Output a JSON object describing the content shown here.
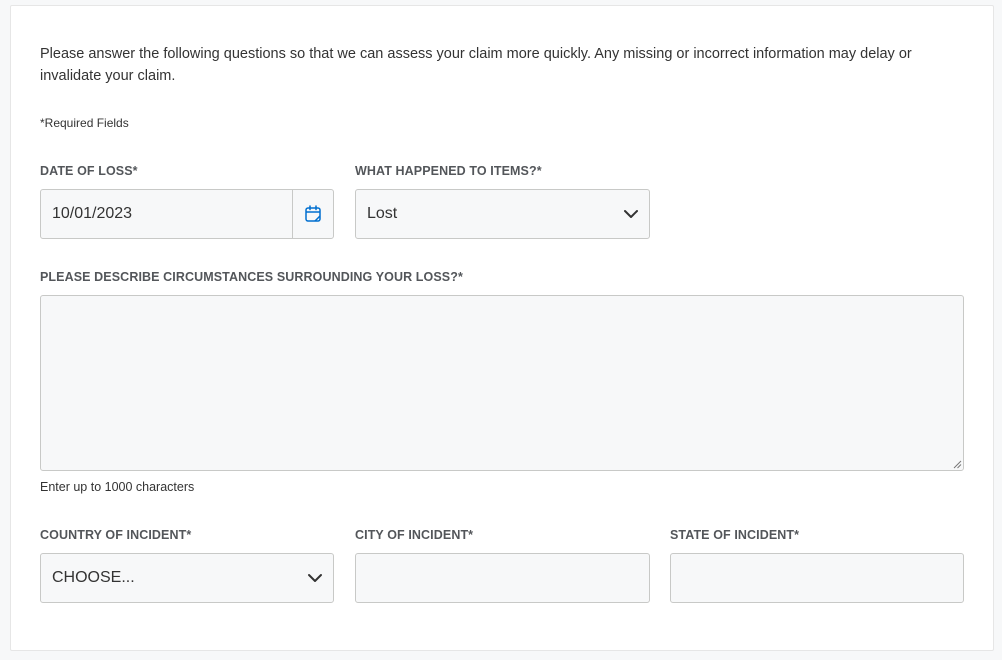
{
  "form": {
    "intro": "Please answer the following questions so that we can assess your claim more quickly. Any missing or incorrect information may delay or invalidate your claim.",
    "required_note": "*Required Fields",
    "date_of_loss": {
      "label": "DATE OF LOSS*",
      "value": "10/01/2023",
      "icon": "calendar-icon"
    },
    "what_happened": {
      "label": "WHAT HAPPENED TO ITEMS?*",
      "selected": "Lost",
      "icon": "chevron-down-icon"
    },
    "circumstances": {
      "label": "PLEASE DESCRIBE CIRCUMSTANCES SURROUNDING YOUR LOSS?*",
      "value": "",
      "hint": "Enter up to 1000 characters"
    },
    "country": {
      "label": "COUNTRY OF INCIDENT*",
      "selected": "CHOOSE...",
      "icon": "chevron-down-icon"
    },
    "city": {
      "label": "CITY OF INCIDENT*",
      "value": ""
    },
    "state": {
      "label": "STATE OF INCIDENT*",
      "value": ""
    }
  },
  "colors": {
    "accent": "#006fcf",
    "field_bg": "#f7f8f9",
    "field_border": "#c8c9c7",
    "label": "#53565a",
    "text": "#333333"
  }
}
